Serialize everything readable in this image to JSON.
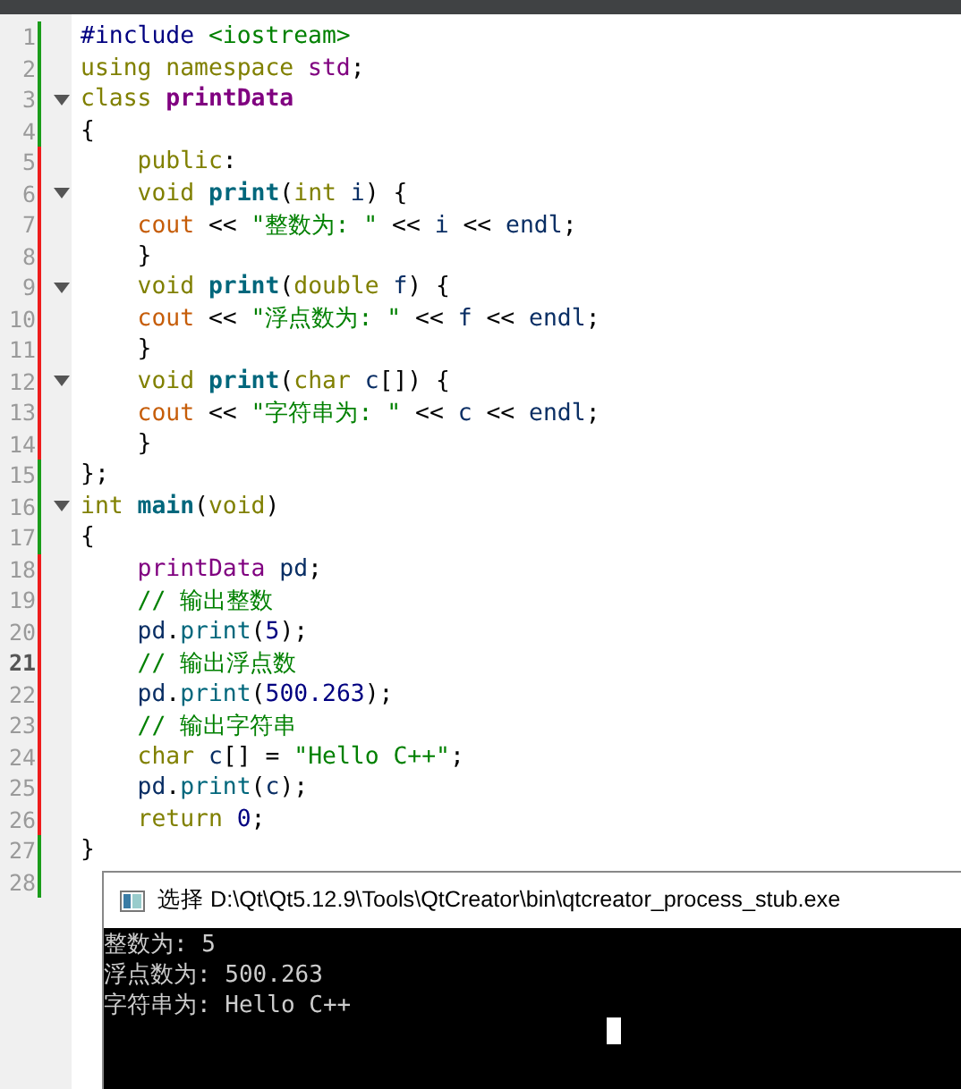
{
  "editor": {
    "lines": [
      {
        "number": "1",
        "modified": false,
        "fold": false,
        "current": false,
        "tokens": [
          {
            "text": "#include ",
            "kind": "preproc"
          },
          {
            "text": "<iostream>",
            "kind": "string"
          }
        ]
      },
      {
        "number": "2",
        "modified": false,
        "fold": false,
        "current": false,
        "tokens": [
          {
            "text": "using ",
            "kind": "keyword"
          },
          {
            "text": "namespace ",
            "kind": "keyword"
          },
          {
            "text": "std",
            "kind": "type"
          },
          {
            "text": ";",
            "kind": "plain"
          }
        ]
      },
      {
        "number": "3",
        "modified": false,
        "fold": true,
        "current": false,
        "tokens": [
          {
            "text": "class ",
            "kind": "keyword"
          },
          {
            "text": "printData",
            "kind": "classname"
          }
        ]
      },
      {
        "number": "4",
        "modified": false,
        "fold": false,
        "current": false,
        "tokens": [
          {
            "text": "{",
            "kind": "plain"
          }
        ]
      },
      {
        "number": "5",
        "modified": true,
        "fold": false,
        "current": false,
        "tokens": [
          {
            "text": "    public",
            "kind": "keyword"
          },
          {
            "text": ":",
            "kind": "plain"
          }
        ]
      },
      {
        "number": "6",
        "modified": true,
        "fold": true,
        "current": false,
        "tokens": [
          {
            "text": "    void ",
            "kind": "keyword"
          },
          {
            "text": "print",
            "kind": "func"
          },
          {
            "text": "(",
            "kind": "plain"
          },
          {
            "text": "int ",
            "kind": "keyword"
          },
          {
            "text": "i",
            "kind": "ident"
          },
          {
            "text": ") {",
            "kind": "plain"
          }
        ]
      },
      {
        "number": "7",
        "modified": true,
        "fold": false,
        "current": false,
        "tokens": [
          {
            "text": "    cout ",
            "kind": "stream"
          },
          {
            "text": "<< ",
            "kind": "plain"
          },
          {
            "text": "\"整数为: \" ",
            "kind": "string"
          },
          {
            "text": "<< ",
            "kind": "plain"
          },
          {
            "text": "i ",
            "kind": "ident"
          },
          {
            "text": "<< ",
            "kind": "plain"
          },
          {
            "text": "endl",
            "kind": "ident"
          },
          {
            "text": ";",
            "kind": "plain"
          }
        ]
      },
      {
        "number": "8",
        "modified": true,
        "fold": false,
        "current": false,
        "tokens": [
          {
            "text": "    }",
            "kind": "plain"
          }
        ]
      },
      {
        "number": "9",
        "modified": true,
        "fold": true,
        "current": false,
        "tokens": [
          {
            "text": "    void ",
            "kind": "keyword"
          },
          {
            "text": "print",
            "kind": "func"
          },
          {
            "text": "(",
            "kind": "plain"
          },
          {
            "text": "double ",
            "kind": "keyword"
          },
          {
            "text": "f",
            "kind": "ident"
          },
          {
            "text": ") {",
            "kind": "plain"
          }
        ]
      },
      {
        "number": "10",
        "modified": true,
        "fold": false,
        "current": false,
        "tokens": [
          {
            "text": "    cout ",
            "kind": "stream"
          },
          {
            "text": "<< ",
            "kind": "plain"
          },
          {
            "text": "\"浮点数为: \" ",
            "kind": "string"
          },
          {
            "text": "<< ",
            "kind": "plain"
          },
          {
            "text": "f ",
            "kind": "ident"
          },
          {
            "text": "<< ",
            "kind": "plain"
          },
          {
            "text": "endl",
            "kind": "ident"
          },
          {
            "text": ";",
            "kind": "plain"
          }
        ]
      },
      {
        "number": "11",
        "modified": true,
        "fold": false,
        "current": false,
        "tokens": [
          {
            "text": "    }",
            "kind": "plain"
          }
        ]
      },
      {
        "number": "12",
        "modified": true,
        "fold": true,
        "current": false,
        "tokens": [
          {
            "text": "    void ",
            "kind": "keyword"
          },
          {
            "text": "print",
            "kind": "func"
          },
          {
            "text": "(",
            "kind": "plain"
          },
          {
            "text": "char ",
            "kind": "keyword"
          },
          {
            "text": "c",
            "kind": "ident"
          },
          {
            "text": "[]) {",
            "kind": "plain"
          }
        ]
      },
      {
        "number": "13",
        "modified": true,
        "fold": false,
        "current": false,
        "tokens": [
          {
            "text": "    cout ",
            "kind": "stream"
          },
          {
            "text": "<< ",
            "kind": "plain"
          },
          {
            "text": "\"字符串为: \" ",
            "kind": "string"
          },
          {
            "text": "<< ",
            "kind": "plain"
          },
          {
            "text": "c ",
            "kind": "ident"
          },
          {
            "text": "<< ",
            "kind": "plain"
          },
          {
            "text": "endl",
            "kind": "ident"
          },
          {
            "text": ";",
            "kind": "plain"
          }
        ]
      },
      {
        "number": "14",
        "modified": true,
        "fold": false,
        "current": false,
        "tokens": [
          {
            "text": "    }",
            "kind": "plain"
          }
        ]
      },
      {
        "number": "15",
        "modified": false,
        "fold": false,
        "current": false,
        "tokens": [
          {
            "text": "};",
            "kind": "plain"
          }
        ]
      },
      {
        "number": "16",
        "modified": false,
        "fold": true,
        "current": false,
        "tokens": [
          {
            "text": "int ",
            "kind": "keyword"
          },
          {
            "text": "main",
            "kind": "func"
          },
          {
            "text": "(",
            "kind": "plain"
          },
          {
            "text": "void",
            "kind": "keyword"
          },
          {
            "text": ")",
            "kind": "plain"
          }
        ]
      },
      {
        "number": "17",
        "modified": false,
        "fold": false,
        "current": false,
        "tokens": [
          {
            "text": "{",
            "kind": "plain"
          }
        ]
      },
      {
        "number": "18",
        "modified": true,
        "fold": false,
        "current": false,
        "tokens": [
          {
            "text": "    printData ",
            "kind": "type"
          },
          {
            "text": "pd",
            "kind": "ident"
          },
          {
            "text": ";",
            "kind": "plain"
          }
        ]
      },
      {
        "number": "19",
        "modified": true,
        "fold": false,
        "current": false,
        "tokens": [
          {
            "text": "    // 输出整数",
            "kind": "comment"
          }
        ]
      },
      {
        "number": "20",
        "modified": true,
        "fold": false,
        "current": false,
        "tokens": [
          {
            "text": "    pd",
            "kind": "ident"
          },
          {
            "text": ".",
            "kind": "plain"
          },
          {
            "text": "print",
            "kind": "method"
          },
          {
            "text": "(",
            "kind": "plain"
          },
          {
            "text": "5",
            "kind": "number"
          },
          {
            "text": ");",
            "kind": "plain"
          }
        ]
      },
      {
        "number": "21",
        "modified": true,
        "fold": false,
        "current": true,
        "tokens": [
          {
            "text": "    // 输出浮点数",
            "kind": "comment"
          }
        ]
      },
      {
        "number": "22",
        "modified": true,
        "fold": false,
        "current": false,
        "tokens": [
          {
            "text": "    pd",
            "kind": "ident"
          },
          {
            "text": ".",
            "kind": "plain"
          },
          {
            "text": "print",
            "kind": "method"
          },
          {
            "text": "(",
            "kind": "plain"
          },
          {
            "text": "500.263",
            "kind": "number"
          },
          {
            "text": ");",
            "kind": "plain"
          }
        ]
      },
      {
        "number": "23",
        "modified": true,
        "fold": false,
        "current": false,
        "tokens": [
          {
            "text": "    // 输出字符串",
            "kind": "comment"
          }
        ]
      },
      {
        "number": "24",
        "modified": true,
        "fold": false,
        "current": false,
        "tokens": [
          {
            "text": "    char ",
            "kind": "keyword"
          },
          {
            "text": "c",
            "kind": "ident"
          },
          {
            "text": "[] = ",
            "kind": "plain"
          },
          {
            "text": "\"Hello C++\"",
            "kind": "string"
          },
          {
            "text": ";",
            "kind": "plain"
          }
        ]
      },
      {
        "number": "25",
        "modified": true,
        "fold": false,
        "current": false,
        "tokens": [
          {
            "text": "    pd",
            "kind": "ident"
          },
          {
            "text": ".",
            "kind": "plain"
          },
          {
            "text": "print",
            "kind": "method"
          },
          {
            "text": "(",
            "kind": "plain"
          },
          {
            "text": "c",
            "kind": "ident"
          },
          {
            "text": ");",
            "kind": "plain"
          }
        ]
      },
      {
        "number": "26",
        "modified": true,
        "fold": false,
        "current": false,
        "tokens": [
          {
            "text": "    return ",
            "kind": "keyword"
          },
          {
            "text": "0",
            "kind": "number"
          },
          {
            "text": ";",
            "kind": "plain"
          }
        ]
      },
      {
        "number": "27",
        "modified": false,
        "fold": false,
        "current": false,
        "tokens": [
          {
            "text": "}",
            "kind": "plain"
          }
        ]
      },
      {
        "number": "28",
        "modified": false,
        "fold": false,
        "current": false
      }
    ]
  },
  "console": {
    "title": "选择 D:\\Qt\\Qt5.12.9\\Tools\\QtCreator\\bin\\qtcreator_process_stub.exe",
    "lines": [
      "整数为: 5",
      "浮点数为: 500.263",
      "字符串为: Hello C++"
    ]
  }
}
